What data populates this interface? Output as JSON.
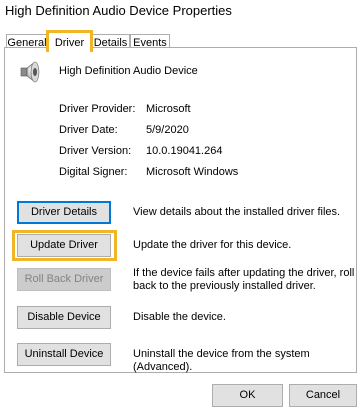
{
  "window": {
    "title": "High Definition Audio Device Properties"
  },
  "tabs": [
    {
      "label": "General",
      "active": false
    },
    {
      "label": "Driver",
      "active": true
    },
    {
      "label": "Details",
      "active": false
    },
    {
      "label": "Events",
      "active": false
    }
  ],
  "device": {
    "icon": "speaker-icon",
    "name": "High Definition Audio Device"
  },
  "info": [
    {
      "label": "Driver Provider:",
      "value": "Microsoft"
    },
    {
      "label": "Driver Date:",
      "value": "5/9/2020"
    },
    {
      "label": "Driver Version:",
      "value": "10.0.19041.264"
    },
    {
      "label": "Digital Signer:",
      "value": "Microsoft Windows"
    }
  ],
  "actions": [
    {
      "label": "Driver Details",
      "description": "View details about the installed driver files.",
      "enabled": true
    },
    {
      "label": "Update Driver",
      "description": "Update the driver for this device.",
      "enabled": true
    },
    {
      "label": "Roll Back Driver",
      "description": "If the device fails after updating the driver, roll back to the previously installed driver.",
      "enabled": false
    },
    {
      "label": "Disable Device",
      "description": "Disable the device.",
      "enabled": true
    },
    {
      "label": "Uninstall Device",
      "description": "Uninstall the device from the system (Advanced).",
      "enabled": true
    }
  ],
  "footer": {
    "ok_label": "OK",
    "cancel_label": "Cancel"
  },
  "colors": {
    "highlight": "#f2b526",
    "focus": "#0078d7",
    "button_face": "#e1e1e1",
    "border": "#adadad"
  }
}
